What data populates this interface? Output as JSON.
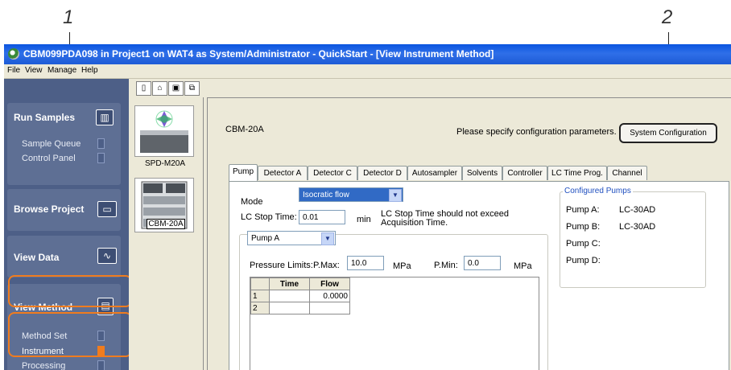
{
  "callouts": {
    "one": "1",
    "two": "2"
  },
  "window": {
    "title": "CBM099PDA098 in Project1 on WAT4 as System/Administrator - QuickStart - [View Instrument Method]",
    "menu": [
      "File",
      "View",
      "Manage",
      "Help"
    ]
  },
  "nav": {
    "run_samples": {
      "label": "Run Samples",
      "items": [
        "Sample Queue",
        "Control Panel"
      ]
    },
    "browse_project": {
      "label": "Browse Project"
    },
    "view_data": {
      "label": "View Data"
    },
    "view_method": {
      "label": "View Method",
      "items": [
        "Method Set",
        "Instrument",
        "Processing"
      ],
      "selected": "Instrument"
    }
  },
  "instruments": [
    "SPD-M20A",
    "CBM-20A"
  ],
  "content": {
    "module_name": "CBM-20A",
    "config_prompt": "Please specify configuration parameters.",
    "config_button": "System Configuration",
    "tabs": [
      "Pump",
      "Detector A",
      "Detector C",
      "Detector D",
      "Autosampler",
      "Solvents",
      "Controller",
      "LC Time Prog.",
      "Channel"
    ],
    "active_tab": "Pump",
    "mode_label": "Mode",
    "mode_value": "Isocratic flow",
    "stop_time_label": "LC Stop Time:",
    "stop_time_value": "0.01",
    "stop_time_unit": "min",
    "stop_time_note": "LC Stop Time should not exceed Acquisition Time.",
    "pump_select": "Pump A",
    "pressure_label": "Pressure Limits:",
    "pmax_label": "P.Max:",
    "pmax_value": "10.0",
    "pmax_unit": "MPa",
    "pmin_label": "P.Min:",
    "pmin_value": "0.0",
    "pmin_unit": "MPa",
    "grid": {
      "headers": [
        "Time",
        "Flow"
      ],
      "rows": [
        [
          "1",
          "",
          "0.0000"
        ],
        [
          "2",
          "",
          ""
        ]
      ]
    },
    "configured_pumps": {
      "title": "Configured Pumps",
      "rows": [
        {
          "label": "Pump A:",
          "value": "LC-30AD"
        },
        {
          "label": "Pump B:",
          "value": "LC-30AD"
        },
        {
          "label": "Pump C:",
          "value": ""
        },
        {
          "label": "Pump D:",
          "value": ""
        }
      ]
    }
  },
  "colors": {
    "highlight": "#f07c1e",
    "nav_bg": "#4d5f87",
    "title_bar": "#0a55e0"
  }
}
